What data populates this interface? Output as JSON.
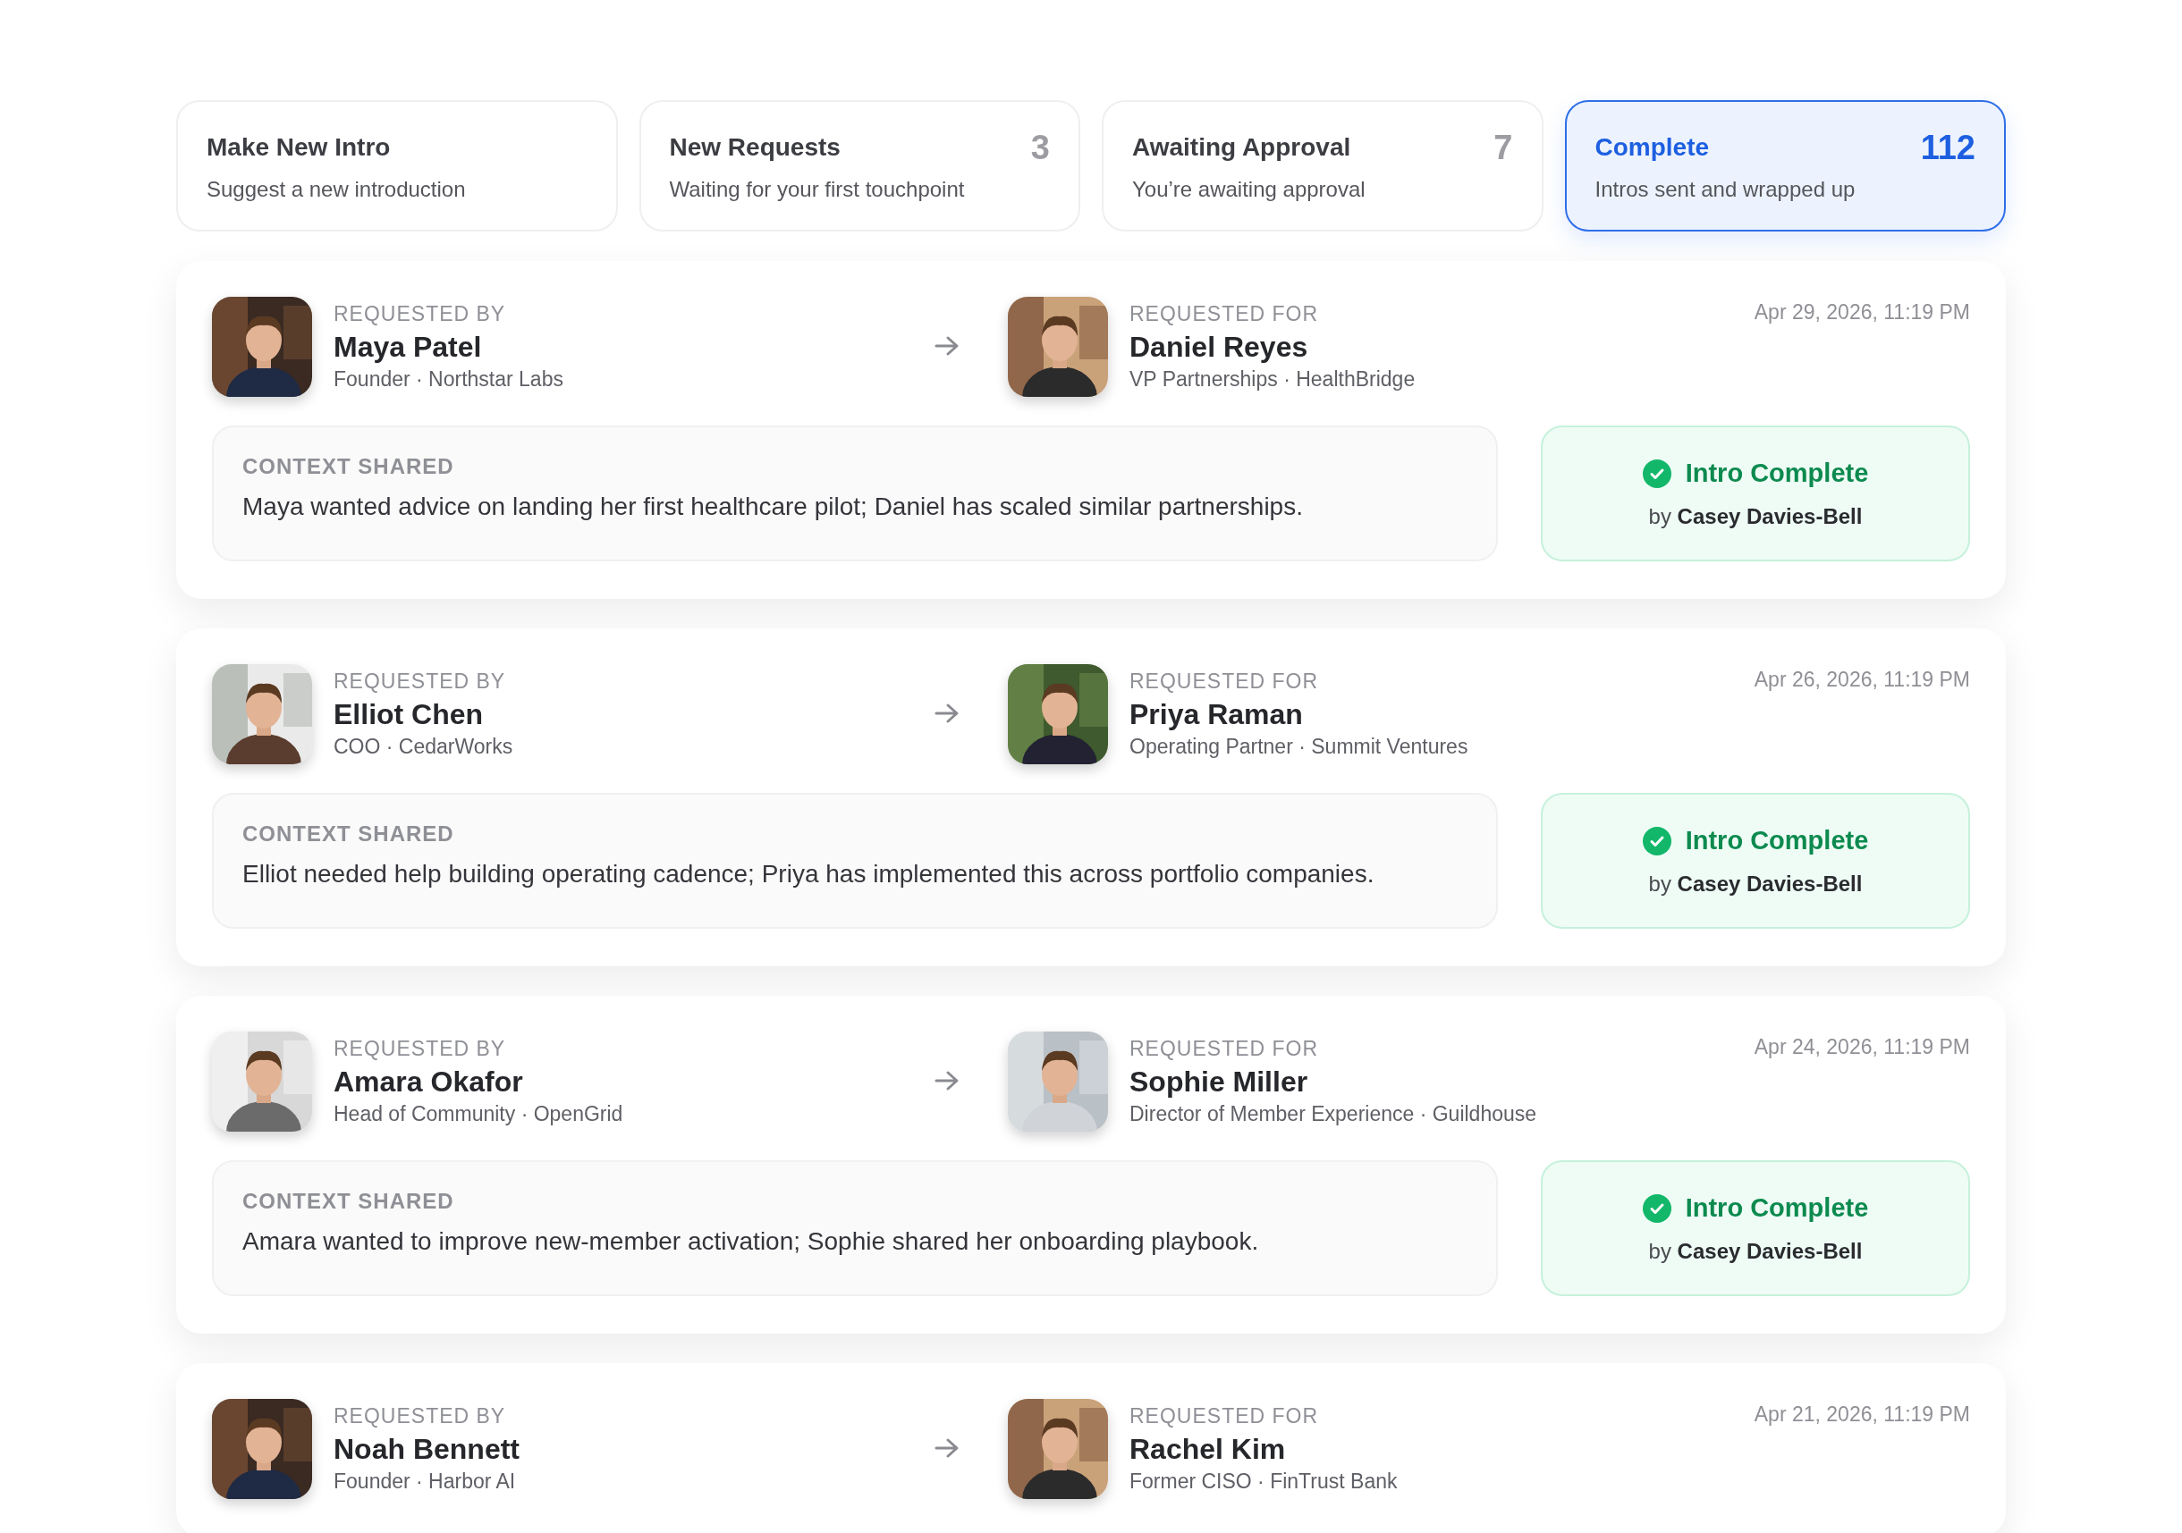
{
  "tabs": [
    {
      "title": "Make New Intro",
      "subtitle": "Suggest a new introduction",
      "selected": false
    },
    {
      "title": "New Requests",
      "subtitle": "Waiting for your first touchpoint",
      "count": "3",
      "selected": false
    },
    {
      "title": "Awaiting Approval",
      "subtitle": "You’re awaiting approval",
      "count": "7",
      "selected": false
    },
    {
      "title": "Complete",
      "subtitle": "Intros sent and wrapped up",
      "count": "112",
      "selected": true
    }
  ],
  "intros": [
    {
      "requested_by": {
        "label": "REQUESTED BY",
        "name": "Maya Patel",
        "role": "Founder · Northstar Labs"
      },
      "requested_for": {
        "label": "REQUESTED FOR",
        "name": "Daniel Reyes",
        "role": "VP Partnerships · HealthBridge"
      },
      "date": "Apr 29, 2026, 11:19 PM",
      "context_label": "CONTEXT SHARED",
      "context": "Maya wanted advice on landing her first healthcare pilot; Daniel has scaled similar partnerships.",
      "status": {
        "kind": "complete",
        "label": "Intro Complete",
        "by": "by **Casey Davies-Bell**"
      }
    },
    {
      "requested_by": {
        "label": "REQUESTED BY",
        "name": "Elliot Chen",
        "role": "COO · CedarWorks"
      },
      "requested_for": {
        "label": "REQUESTED FOR",
        "name": "Priya Raman",
        "role": "Operating Partner · Summit Ventures"
      },
      "date": "Apr 26, 2026, 11:19 PM",
      "context_label": "CONTEXT SHARED",
      "context": "Elliot needed help building operating cadence; Priya has implemented this across portfolio companies.",
      "status": {
        "kind": "complete",
        "label": "Intro Complete",
        "by": "by **Casey Davies-Bell**"
      }
    },
    {
      "requested_by": {
        "label": "REQUESTED BY",
        "name": "Amara Okafor",
        "role": "Head of Community · OpenGrid"
      },
      "requested_for": {
        "label": "REQUESTED FOR",
        "name": "Sophie Miller",
        "role": "Director of Member Experience · Guildhouse"
      },
      "date": "Apr 24, 2026, 11:19 PM",
      "context_label": "CONTEXT SHARED",
      "context": "Amara wanted to improve new-member activation; Sophie shared her onboarding playbook.",
      "status": {
        "kind": "complete",
        "label": "Intro Complete",
        "by": "by **Casey Davies-Bell**"
      }
    },
    {
      "requested_by": {
        "label": "REQUESTED BY",
        "name": "Noah Bennett",
        "role": "Founder · Harbor AI"
      },
      "requested_for": {
        "label": "REQUESTED FOR",
        "name": "Rachel Kim",
        "role": "Former CISO · FinTrust Bank"
      },
      "date": "Apr 21, 2026, 11:19 PM"
    }
  ]
}
